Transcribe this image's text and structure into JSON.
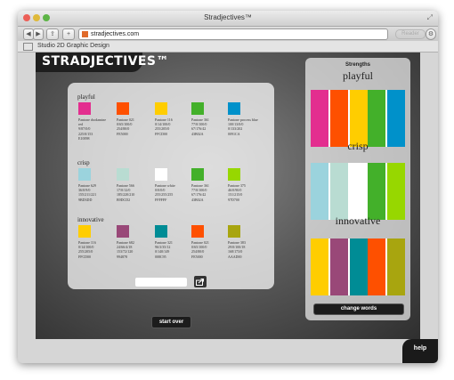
{
  "window": {
    "title": "Stradjectives™"
  },
  "toolbar": {
    "url": "stradjectives.com",
    "reader_label": "Reader"
  },
  "bookmarks": {
    "item": "Studio 2D Graphic Design"
  },
  "site": {
    "logo": "STRADJECTIVES™",
    "start_over": "start over",
    "help": "help",
    "groups": [
      {
        "name": "playful",
        "colors": [
          {
            "hex": "#e32e8f",
            "lines": [
              "Pantone rhodamine",
              "red",
              "9/87/0/0",
              "225/0/153",
              "E10098"
            ]
          },
          {
            "hex": "#fe5000",
            "lines": [
              "Pantone 021",
              "0/65/100/0",
              "254/80/0",
              "FE5000"
            ]
          },
          {
            "hex": "#ffcd00",
            "lines": [
              "Pantone 116",
              "0/14/100/0",
              "255/205/0",
              "FFCD00"
            ]
          },
          {
            "hex": "#43b02a",
            "lines": [
              "Pantone 361",
              "77/0/100/0",
              "67/176/42",
              "43B02A"
            ]
          },
          {
            "hex": "#0091ca",
            "lines": [
              "Pantone process blue",
              "100/13/0/0",
              "0/133/202",
              "0091CA"
            ]
          }
        ]
      },
      {
        "name": "crisp",
        "colors": [
          {
            "hex": "#9bd3dd",
            "lines": [
              "Pantone 629",
              "36/0/9/0",
              "155/211/221",
              "9BD3DD"
            ]
          },
          {
            "hex": "#b9dcd2",
            "lines": [
              "Pantone 566",
              "17/0/12/0",
              "185/220/210",
              "B9DCD2"
            ]
          },
          {
            "hex": "#ffffff",
            "lines": [
              "Pantone white",
              "0/0/0/0",
              "255/255/255",
              "FFFFFF"
            ]
          },
          {
            "hex": "#43b02a",
            "lines": [
              "Pantone 361",
              "77/0/100/0",
              "67/176/42",
              "43B02A"
            ]
          },
          {
            "hex": "#97d700",
            "lines": [
              "Pantone 375",
              "46/0/90/0",
              "151/215/0",
              "97D700"
            ]
          }
        ]
      },
      {
        "name": "innovative",
        "colors": [
          {
            "hex": "#ffcd00",
            "lines": [
              "Pantone 116",
              "0/14/100/0",
              "255/205/0",
              "FFCD00"
            ]
          },
          {
            "hex": "#994878",
            "lines": [
              "Pantone 682",
              "24/66/4/18",
              "153/72/120",
              "994878"
            ]
          },
          {
            "hex": "#008c95",
            "lines": [
              "Pantone 321",
              "96/3/35/12",
              "0/140/149",
              "008C95"
            ]
          },
          {
            "hex": "#fe5000",
            "lines": [
              "Pantone 021",
              "0/65/100/0",
              "254/80/0",
              "FE5000"
            ]
          },
          {
            "hex": "#a8a50f",
            "lines": [
              "Pantone 383",
              "29/0/100/18",
              "168/173/0",
              "AAAD00"
            ]
          }
        ]
      }
    ],
    "strengths": {
      "heading": "Strengths",
      "change_words": "change words"
    }
  }
}
